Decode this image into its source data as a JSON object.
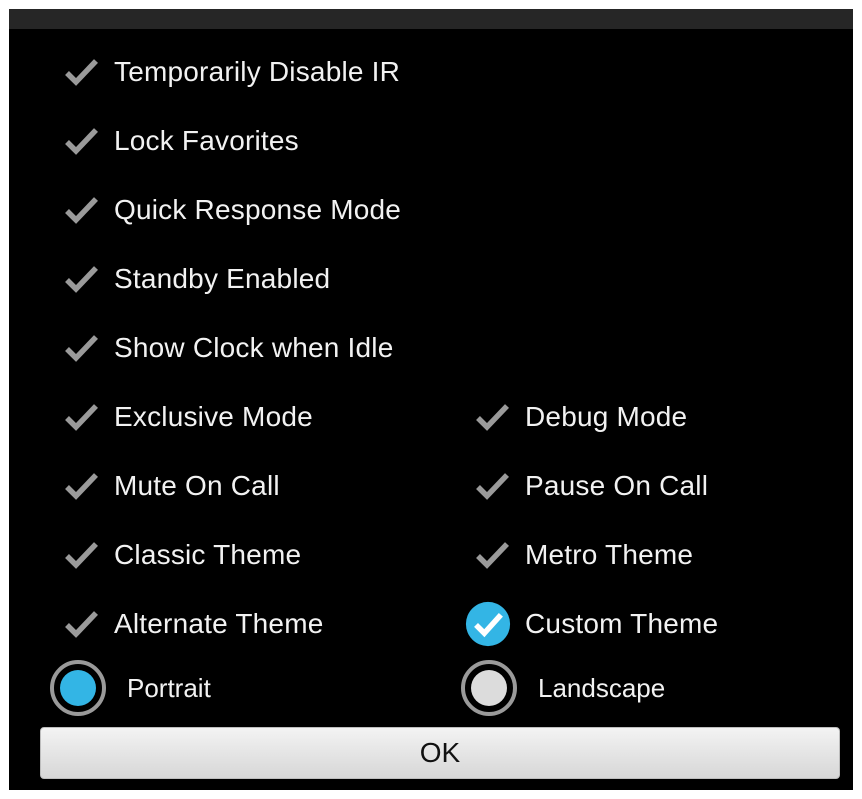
{
  "colors": {
    "background": "#000000",
    "accent": "#33b5e5",
    "check_gray": "#9a9a9a",
    "radio_unselected": "#dcdcdc",
    "text": "#f2f2f2"
  },
  "options": {
    "temporarily_disable_ir": {
      "label": "Temporarily Disable IR",
      "checked": false
    },
    "lock_favorites": {
      "label": "Lock Favorites",
      "checked": false
    },
    "quick_response_mode": {
      "label": "Quick Response Mode",
      "checked": false
    },
    "standby_enabled": {
      "label": "Standby Enabled",
      "checked": false
    },
    "show_clock_when_idle": {
      "label": "Show Clock when Idle",
      "checked": false
    },
    "exclusive_mode": {
      "label": "Exclusive Mode",
      "checked": false
    },
    "debug_mode": {
      "label": "Debug Mode",
      "checked": false
    },
    "mute_on_call": {
      "label": "Mute On Call",
      "checked": false
    },
    "pause_on_call": {
      "label": "Pause On Call",
      "checked": false
    },
    "classic_theme": {
      "label": "Classic Theme",
      "checked": false
    },
    "metro_theme": {
      "label": "Metro Theme",
      "checked": false
    },
    "alternate_theme": {
      "label": "Alternate Theme",
      "checked": false
    },
    "custom_theme": {
      "label": "Custom Theme",
      "checked": true
    }
  },
  "orientation": {
    "portrait": {
      "label": "Portrait",
      "selected": true
    },
    "landscape": {
      "label": "Landscape",
      "selected": false
    }
  },
  "ok_label": "OK"
}
